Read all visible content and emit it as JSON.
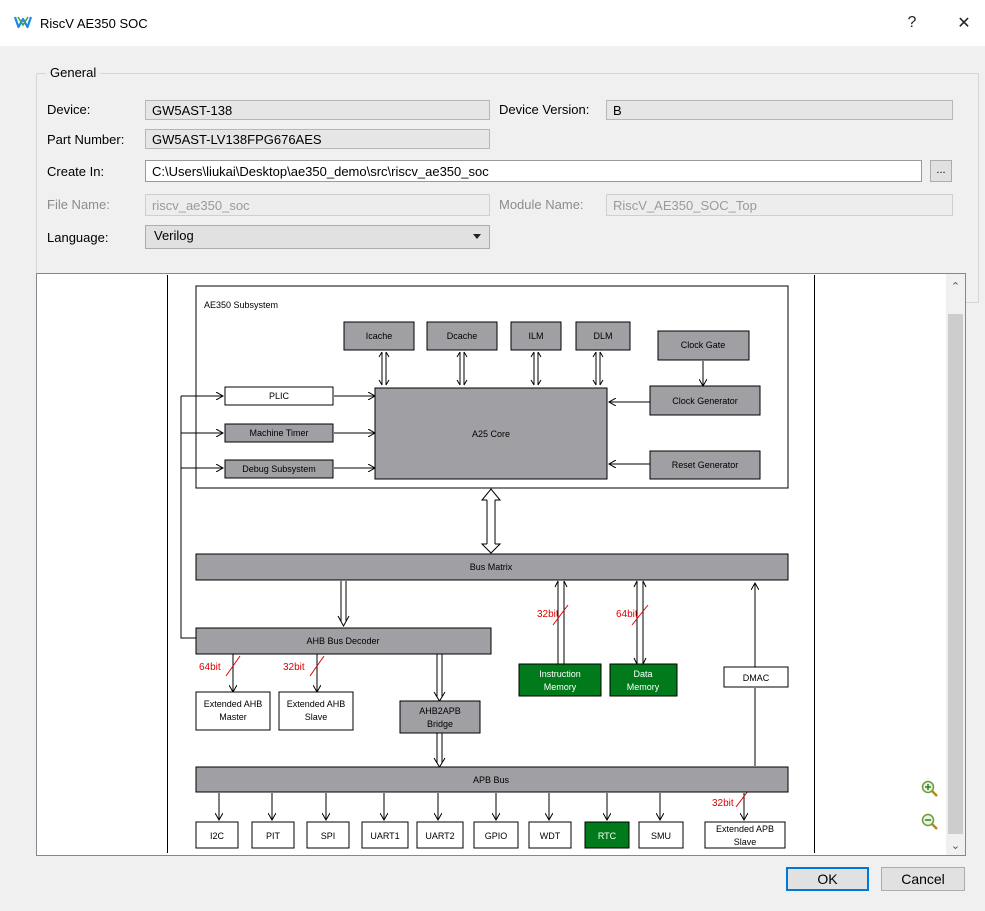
{
  "window": {
    "title": "RiscV AE350 SOC",
    "help": "?",
    "close": "✕"
  },
  "general": {
    "title": "General",
    "device_label": "Device:",
    "device_value": "GW5AST-138",
    "device_version_label": "Device Version:",
    "device_version_value": "B",
    "part_number_label": "Part Number:",
    "part_number_value": "GW5AST-LV138FPG676AES",
    "create_in_label": "Create In:",
    "create_in_value": "C:\\Users\\liukai\\Desktop\\ae350_demo\\src\\riscv_ae350_soc",
    "browse_label": "...",
    "file_name_label": "File Name:",
    "file_name_value": "riscv_ae350_soc",
    "module_name_label": "Module Name:",
    "module_name_value": "RiscV_AE350_SOC_Top",
    "language_label": "Language:",
    "language_value": "Verilog"
  },
  "diagram": {
    "subsystem_title": "AE350 Subsystem",
    "icache": "Icache",
    "dcache": "Dcache",
    "ilm": "ILM",
    "dlm": "DLM",
    "clock_gate": "Clock Gate",
    "clock_generator": "Clock Generator",
    "reset_generator": "Reset Generator",
    "plic": "PLIC",
    "machine_timer": "Machine Timer",
    "debug_subsystem": "Debug Subsystem",
    "core": "A25 Core",
    "bus_matrix": "Bus Matrix",
    "ahb_decoder": "AHB Bus Decoder",
    "ext_ahb_master_1": "Extended AHB",
    "ext_ahb_master_2": "Master",
    "ext_ahb_slave_1": "Extended AHB",
    "ext_ahb_slave_2": "Slave",
    "ahb2apb_1": "AHB2APB",
    "ahb2apb_2": "Bridge",
    "instr_mem_1": "Instruction",
    "instr_mem_2": "Memory",
    "data_mem_1": "Data",
    "data_mem_2": "Memory",
    "dmac": "DMAC",
    "apb_bus": "APB Bus",
    "w_64bit_a": "64bit",
    "w_32bit_a": "32bit",
    "w_32bit_b": "32bit",
    "w_64bit_b": "64bit",
    "w_32bit_c": "32bit",
    "periph_i2c": "I2C",
    "periph_pit": "PIT",
    "periph_spi": "SPI",
    "periph_uart1": "UART1",
    "periph_uart2": "UART2",
    "periph_gpio": "GPIO",
    "periph_wdt": "WDT",
    "periph_rtc": "RTC",
    "periph_smu": "SMU",
    "ext_apb_slave_1": "Extended APB",
    "ext_apb_slave_2": "Slave"
  },
  "buttons": {
    "ok": "OK",
    "cancel": "Cancel"
  },
  "icons": {
    "app": "gowin-logo-icon",
    "zoom_in": "zoom-in-icon",
    "zoom_out": "zoom-out-icon"
  },
  "colors": {
    "green_block": "#007a1a",
    "gray_block": "#a0a0a4",
    "accent": "#0078d7"
  }
}
